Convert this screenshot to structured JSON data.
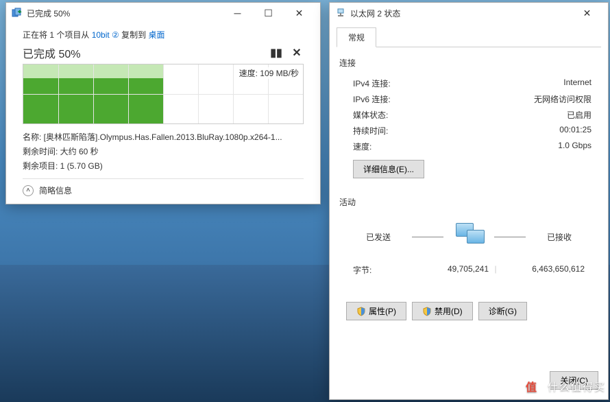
{
  "copy_window": {
    "title": "已完成 50%",
    "line1_prefix": "正在将 1 个项目从 ",
    "line1_source": "10bit ②",
    "line1_mid": " 复制到 ",
    "line1_dest": "桌面",
    "progress_text": "已完成 50%",
    "speed_label": "速度: 109 MB/秒",
    "name_line": "名称: [奥林匹斯陷落].Olympus.Has.Fallen.2013.BluRay.1080p.x264-1...",
    "remaining_time": "剩余时间: 大约 60 秒",
    "remaining_items": "剩余项目: 1 (5.70 GB)",
    "collapse_label": "简略信息"
  },
  "eth_window": {
    "title": "以太网 2 状态",
    "tab_general": "常规",
    "group_conn": "连接",
    "ipv4_k": "IPv4 连接:",
    "ipv4_v": "Internet",
    "ipv6_k": "IPv6 连接:",
    "ipv6_v": "无网络访问权限",
    "media_k": "媒体状态:",
    "media_v": "已启用",
    "duration_k": "持续时间:",
    "duration_v": "00:01:25",
    "speed_k": "速度:",
    "speed_v": "1.0 Gbps",
    "details_btn": "详细信息(E)...",
    "group_activity": "活动",
    "sent_label": "已发送",
    "recv_label": "已接收",
    "bytes_label": "字节:",
    "bytes_sent": "49,705,241",
    "bytes_recv": "6,463,650,612",
    "btn_props": "属性(P)",
    "btn_disable": "禁用(D)",
    "btn_diag": "诊断(G)",
    "btn_close": "关闭(C)"
  },
  "watermark": "什么值得买"
}
